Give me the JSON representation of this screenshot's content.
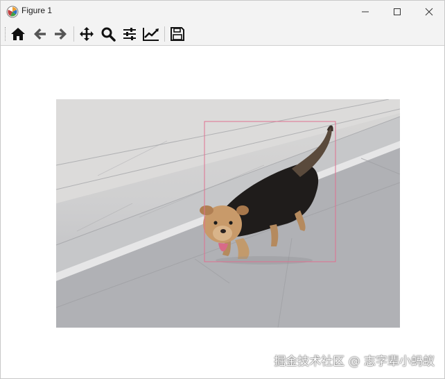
{
  "window": {
    "title": "Figure 1",
    "controls": [
      "minimize",
      "maximize",
      "close"
    ]
  },
  "toolbar": {
    "buttons": [
      {
        "icon": "home-icon"
      },
      {
        "icon": "back-arrow-icon"
      },
      {
        "icon": "forward-arrow-icon"
      },
      {
        "icon": "pan-move-icon"
      },
      {
        "icon": "zoom-magnifier-icon"
      },
      {
        "icon": "configure-subplots-icon"
      },
      {
        "icon": "edit-axis-icon"
      },
      {
        "icon": "save-floppy-icon"
      }
    ]
  },
  "figure": {
    "content": "photo of a small terrier dog walking on pavement",
    "annotation": "bounding box around the dog",
    "box_color": "#e07090"
  },
  "watermark": {
    "text": "掘金技术社区 @ 志字辈小蚂蚁"
  }
}
